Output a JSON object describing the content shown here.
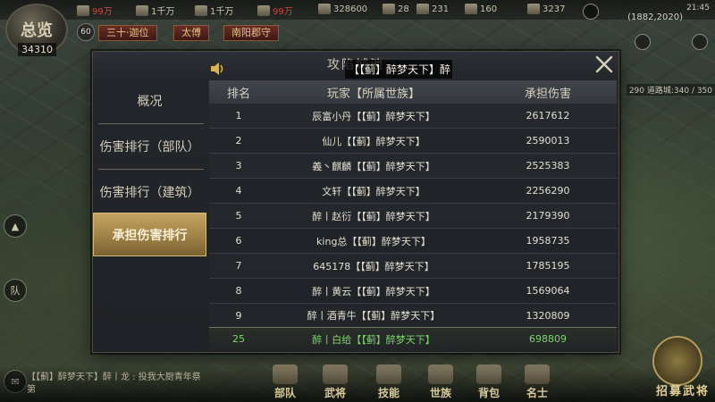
{
  "hud": {
    "overview_label": "总览",
    "overview_value": "34310",
    "level": "60",
    "resources": [
      "99万",
      "1千万",
      "1千万",
      "99万",
      "328600",
      "28",
      "231",
      "160",
      "3237"
    ],
    "tabs": [
      "三十·迦位",
      "太傅",
      "南阳郡守"
    ],
    "time": "21:45",
    "coords": "(1882,2020)",
    "side_text": "290 道路城:340 / 350"
  },
  "chat": {
    "line1": "【【蓟】醉梦天下】醉丨龙 : 投我大厨青年祭",
    "line2": "第"
  },
  "bottom_menu": [
    "部队",
    "武将",
    "技能",
    "世族",
    "背包",
    "名士"
  ],
  "recruit_label": "招募武将",
  "modal": {
    "title": "攻陷城池",
    "announcement": "【【蓟】醉梦天下】醉",
    "nav": [
      {
        "label": "概况",
        "active": false
      },
      {
        "label": "伤害排行（部队）",
        "active": false
      },
      {
        "label": "伤害排行（建筑）",
        "active": false
      },
      {
        "label": "承担伤害排行",
        "active": true
      }
    ],
    "columns": {
      "rank": "排名",
      "player": "玩家【所属世族】",
      "damage": "承担伤害"
    },
    "rows": [
      {
        "rank": "1",
        "player": "辰富小丹【【蓟】醉梦天下】",
        "damage": "2617612"
      },
      {
        "rank": "2",
        "player": "仙儿【【蓟】醉梦天下】",
        "damage": "2590013"
      },
      {
        "rank": "3",
        "player": "義丶麒麟【【蓟】醉梦天下】",
        "damage": "2525383"
      },
      {
        "rank": "4",
        "player": "文轩【【蓟】醉梦天下】",
        "damage": "2256290"
      },
      {
        "rank": "5",
        "player": "醉丨赵衍【【蓟】醉梦天下】",
        "damage": "2179390"
      },
      {
        "rank": "6",
        "player": "king总【【蓟】醉梦天下】",
        "damage": "1958735"
      },
      {
        "rank": "7",
        "player": "645178【【蓟】醉梦天下】",
        "damage": "1785195"
      },
      {
        "rank": "8",
        "player": "醉丨黄云【【蓟】醉梦天下】",
        "damage": "1569064"
      },
      {
        "rank": "9",
        "player": "醉丨酒青牛【【蓟】醉梦天下】",
        "damage": "1320809"
      }
    ],
    "self_row": {
      "rank": "25",
      "player": "醉丨白给【【蓟】醉梦天下】",
      "damage": "698809"
    }
  },
  "colors": {
    "accent_gold": "#c4a462",
    "self_green": "#7bd66b",
    "resource_red": "#d2473e"
  }
}
